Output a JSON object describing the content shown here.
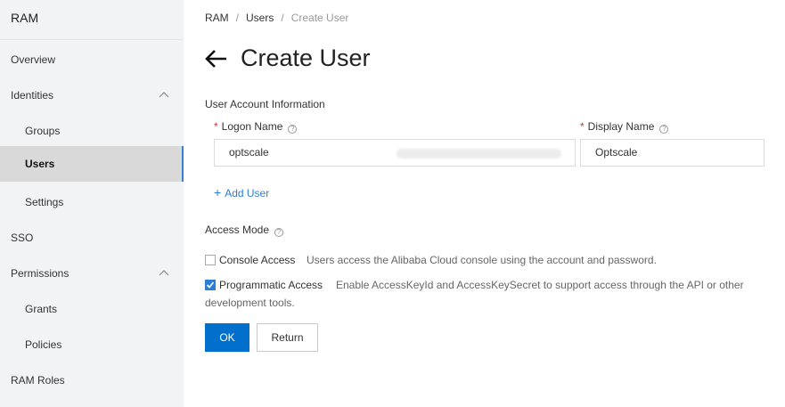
{
  "sidebar": {
    "title": "RAM",
    "items": [
      {
        "label": "Overview"
      },
      {
        "label": "Identities"
      },
      {
        "label": "Groups"
      },
      {
        "label": "Users"
      },
      {
        "label": "Settings"
      },
      {
        "label": "SSO"
      },
      {
        "label": "Permissions"
      },
      {
        "label": "Grants"
      },
      {
        "label": "Policies"
      },
      {
        "label": "RAM Roles"
      }
    ],
    "chevron_icon": "chevron-up-icon"
  },
  "breadcrumb": {
    "items": [
      "RAM",
      "Users",
      "Create User"
    ],
    "separator": "/"
  },
  "header": {
    "back_icon": "arrow-left-icon",
    "title": "Create User"
  },
  "form": {
    "section_label": "User Account Information",
    "required_mark": "*",
    "help_icon": "?",
    "logon_name": {
      "label": "Logon Name",
      "value": "optscale"
    },
    "display_name": {
      "label": "Display Name",
      "value": "Optscale"
    },
    "add_user": {
      "icon": "+",
      "label": "Add User"
    },
    "access_mode": {
      "label": "Access Mode",
      "options": [
        {
          "label": "Console Access",
          "description": "Users access the Alibaba Cloud console using the account and password.",
          "checked": false
        },
        {
          "label": "Programmatic Access",
          "description": "Enable AccessKeyId and AccessKeySecret to support access through the API or other",
          "description_cont": "development tools.",
          "checked": true
        }
      ]
    }
  },
  "actions": {
    "ok": "OK",
    "return": "Return"
  },
  "colors": {
    "primary": "#0070cc",
    "link": "#2c7dd6",
    "required": "#d93026",
    "sidebar_bg": "#f2f3f5",
    "sidebar_active_bg": "#d9d9d9"
  }
}
